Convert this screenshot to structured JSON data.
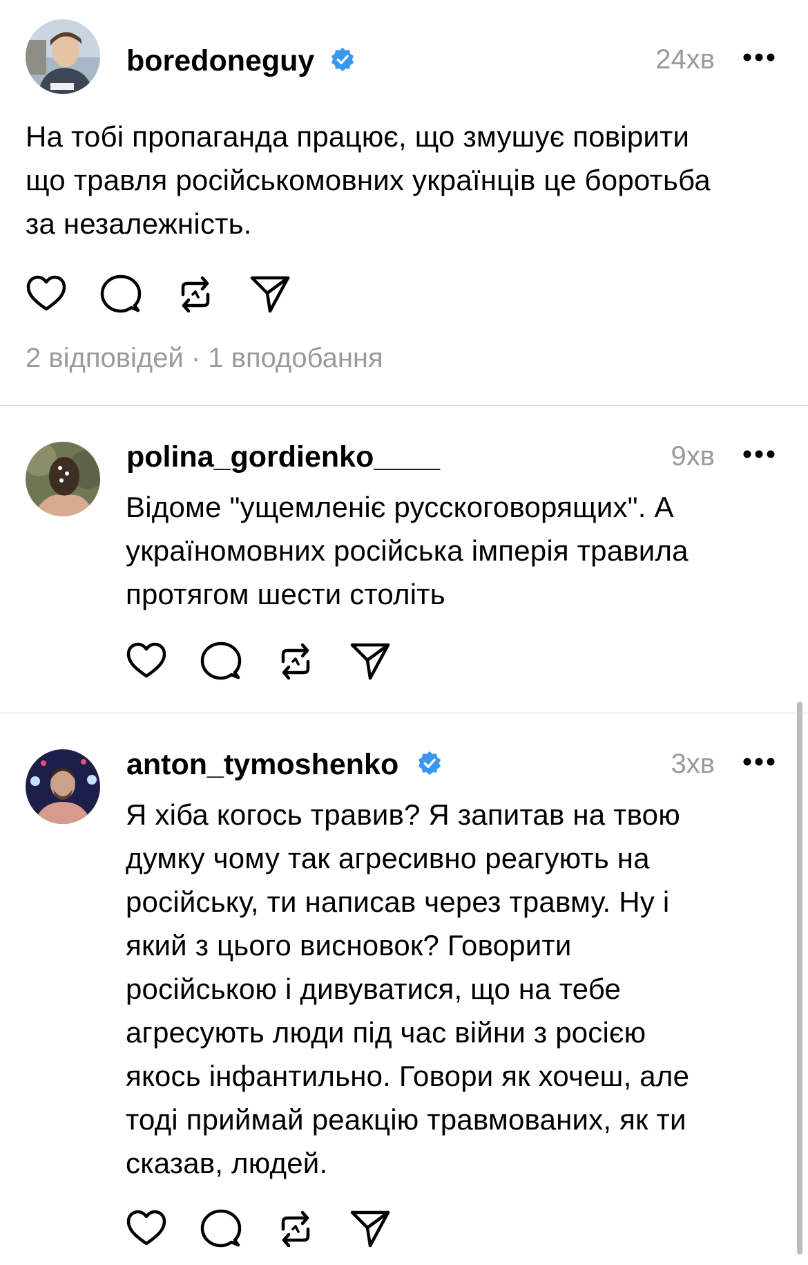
{
  "posts": [
    {
      "username": "boredoneguy",
      "verified": true,
      "time": "24хв",
      "text": "На тобі пропаганда працює, що змушує повірити\nщо травля російськомовних українців це боротьба\nза незалежність.",
      "meta": "2 відповідей · 1 вподобання"
    },
    {
      "username": "polina_gordienko____",
      "verified": false,
      "time": "9хв",
      "text": "Відоме \"ущемленіє русскоговорящих\". А\nукраїномовних російська імперія травила\nпротягом шести століть"
    },
    {
      "username": "anton_tymoshenko",
      "verified": true,
      "time": "3хв",
      "text": "Я хіба когось травив? Я запитав на твою\nдумку чому так агресивно реагують на\nросійську, ти написав через травму. Ну і\nякий з цього висновок? Говорити\nросійською і дивуватися, що на тебе\nагресують люди під час війни з росією\nякось інфантильно. Говори як хочеш, але\nтоді приймай реакцію травмованих, як ти\nсказав, людей."
    }
  ],
  "icons": {
    "like": "heart-icon",
    "reply": "comment-icon",
    "repost": "repost-icon",
    "share": "send-icon",
    "more": "more-icon",
    "verified": "verified-badge-icon"
  },
  "colors": {
    "verified": "#3897f0",
    "muted": "#9a9a9a",
    "divider": "#d6d6d6"
  }
}
